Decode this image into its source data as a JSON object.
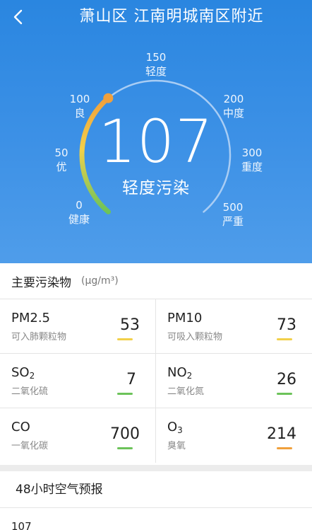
{
  "header": {
    "title": "萧山区 江南明城南区附近"
  },
  "gauge": {
    "value": "107",
    "level": "轻度污染",
    "scale_max": 500,
    "colors": {
      "green": "#6cc35a",
      "yellow": "#f2d04a",
      "orange": "#f0a03c",
      "track": "#a9cdf4"
    },
    "ticks": [
      {
        "value": "0",
        "label": "健康"
      },
      {
        "value": "50",
        "label": "优"
      },
      {
        "value": "100",
        "label": "良"
      },
      {
        "value": "150",
        "label": "轻度"
      },
      {
        "value": "200",
        "label": "中度"
      },
      {
        "value": "300",
        "label": "重度"
      },
      {
        "value": "500",
        "label": "严重"
      }
    ]
  },
  "pollutants": {
    "title": "主要污染物",
    "unit": "(μg/m³)",
    "items": [
      {
        "name": "PM2.5",
        "sub": "",
        "desc": "可入肺颗粒物",
        "value": "53",
        "color": "#f2d04a"
      },
      {
        "name": "PM10",
        "sub": "",
        "desc": "可吸入颗粒物",
        "value": "73",
        "color": "#f2d04a"
      },
      {
        "name": "SO",
        "sub": "2",
        "desc": "二氧化硫",
        "value": "7",
        "color": "#6cc35a"
      },
      {
        "name": "NO",
        "sub": "2",
        "desc": "二氧化氮",
        "value": "26",
        "color": "#6cc35a"
      },
      {
        "name": "CO",
        "sub": "",
        "desc": "一氧化碳",
        "value": "700",
        "color": "#6cc35a"
      },
      {
        "name": "O",
        "sub": "3",
        "desc": "臭氧",
        "value": "214",
        "color": "#f0a03c"
      }
    ]
  },
  "forecast": {
    "title": "48小时空气预报",
    "first_value": "107"
  }
}
